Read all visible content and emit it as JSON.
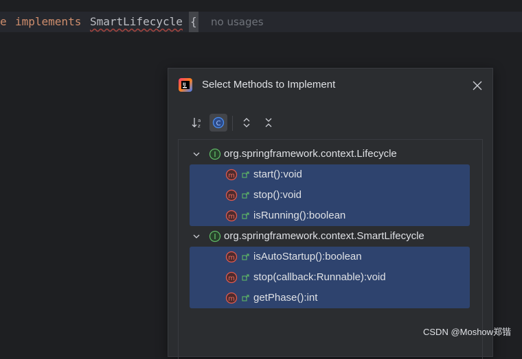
{
  "editor": {
    "line_prefix": "e",
    "keyword": "implements",
    "type_name": "SmartLifecycle",
    "brace": "{",
    "usage_hint": "no usages"
  },
  "dialog": {
    "title": "Select Methods to Implement",
    "groups": [
      {
        "label": "org.springframework.context.Lifecycle",
        "icon": "interface-icon",
        "methods": [
          {
            "label": "start():void",
            "icon": "method-icon"
          },
          {
            "label": "stop():void",
            "icon": "method-icon"
          },
          {
            "label": "isRunning():boolean",
            "icon": "method-icon"
          }
        ]
      },
      {
        "label": "org.springframework.context.SmartLifecycle",
        "icon": "interface-icon",
        "methods": [
          {
            "label": "isAutoStartup():boolean",
            "icon": "method-icon"
          },
          {
            "label": "stop(callback:Runnable):void",
            "icon": "method-icon"
          },
          {
            "label": "getPhase():int",
            "icon": "method-icon"
          }
        ]
      }
    ],
    "toolbar": [
      "sort-alphabetically-icon",
      "show-classes-icon",
      "expand-all-icon",
      "collapse-all-icon"
    ]
  },
  "watermark": "CSDN @Moshow郑锴",
  "colors": {
    "editor_bg": "#1e1f22",
    "dialog_bg": "#2b2d30",
    "selection": "#2e436e",
    "keyword": "#cf8e6d",
    "method_icon": "#e05a4f",
    "interface_icon": "#5fb865",
    "toggle_icon": "#4a8ef0"
  }
}
